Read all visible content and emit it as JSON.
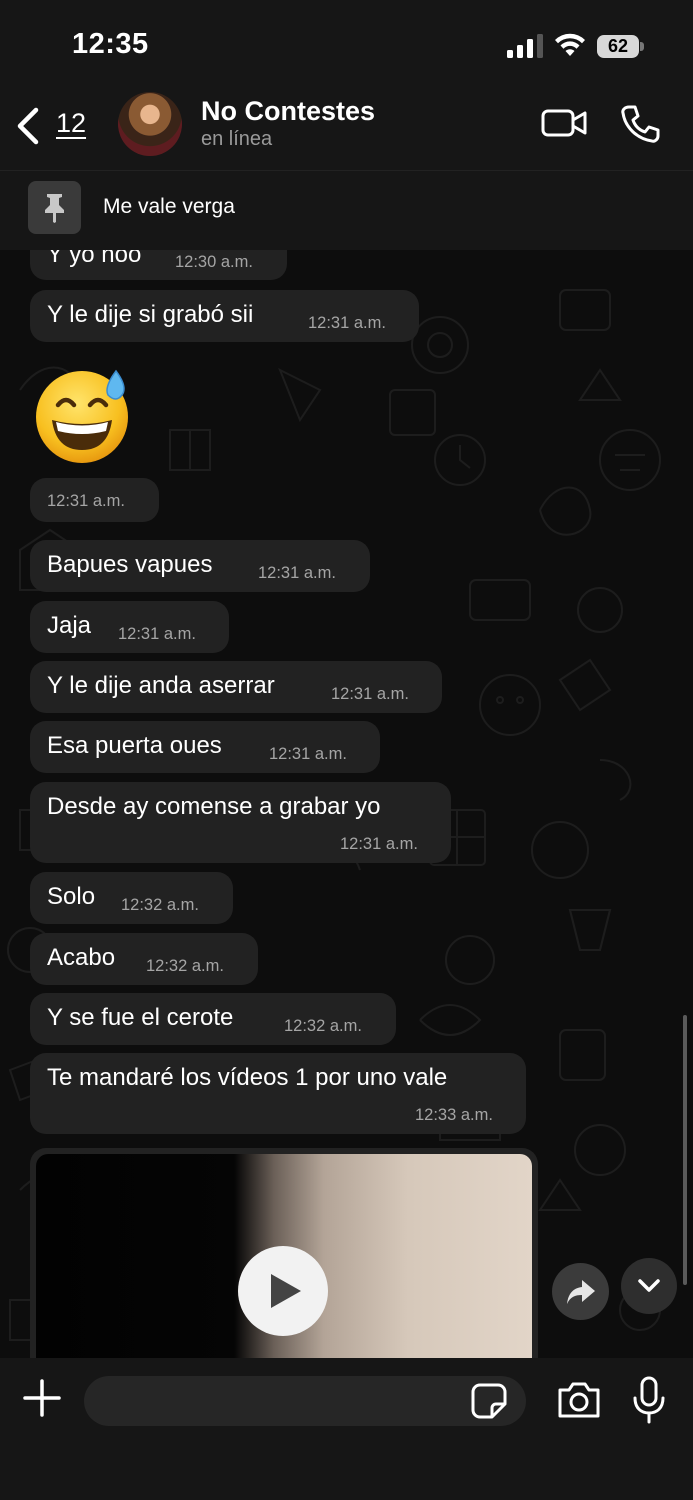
{
  "status_bar": {
    "time": "12:35",
    "battery": "62"
  },
  "header": {
    "back_count": "12",
    "contact_name": "No Contestes",
    "contact_status": "en línea"
  },
  "pinned": {
    "text": "Me vale verga"
  },
  "messages": [
    {
      "text": "Y yo noo",
      "time": "12:30 a.m."
    },
    {
      "text": "Y le dije si grabó sii",
      "time": "12:31 a.m."
    },
    {
      "emoji": "grinning-face-with-sweat",
      "time": "12:31 a.m."
    },
    {
      "text": "Bapues vapues",
      "time": "12:31 a.m."
    },
    {
      "text": "Jaja",
      "time": "12:31 a.m."
    },
    {
      "text": "Y le dije anda aserrar",
      "time": "12:31 a.m."
    },
    {
      "text": "Esa puerta oues",
      "time": "12:31 a.m."
    },
    {
      "text": "Desde ay comense a grabar yo",
      "time": "12:31 a.m."
    },
    {
      "text": "Solo",
      "time": "12:32 a.m."
    },
    {
      "text": "Acabo",
      "time": "12:32 a.m."
    },
    {
      "text": "Y se fue el cerote",
      "time": "12:32 a.m."
    },
    {
      "text": "Te mandaré los vídeos 1 por uno vale",
      "time": "12:33 a.m."
    }
  ],
  "composer": {
    "placeholder": ""
  },
  "icons": [
    "back-chevron-icon",
    "video-camera-icon",
    "phone-icon",
    "pin-icon",
    "play-icon",
    "forward-icon",
    "chevron-down-icon",
    "plus-icon",
    "sticker-icon",
    "camera-icon",
    "microphone-icon"
  ],
  "colors": {
    "background": "#0b0b0b",
    "bar": "#161616",
    "bubble": "#222222",
    "timestamp": "#a5a5a5",
    "subtitle": "#9a9a9a"
  }
}
